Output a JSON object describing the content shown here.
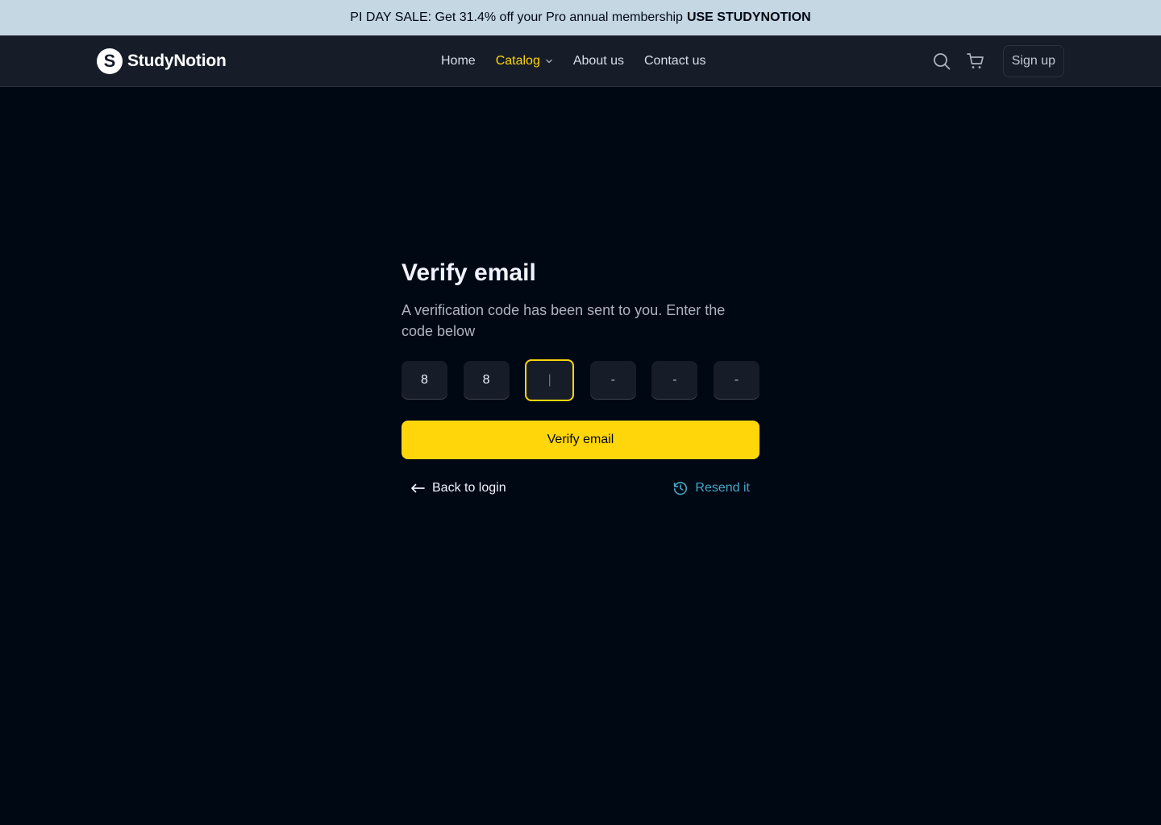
{
  "promo": {
    "text": "PI DAY SALE: Get 31.4% off your Pro annual membership",
    "code": "USE STUDYNOTION",
    "background": "#C5D7E3"
  },
  "navbar": {
    "logo_mark": "S",
    "logo_text": "StudyNotion",
    "links": [
      {
        "label": "Home"
      },
      {
        "label": "Catalog",
        "active": true,
        "icon": "chevron-down-icon"
      },
      {
        "label": "About us"
      },
      {
        "label": "Contact us"
      }
    ],
    "actions": {
      "search_icon": "search-icon",
      "cart_icon": "cart-icon",
      "signup_label": "Sign up"
    },
    "accent": "#FFD60A"
  },
  "verify": {
    "title": "Verify email",
    "subtitle": "A verification code has been sent to you. Enter the code below",
    "otp": [
      {
        "value": "8"
      },
      {
        "value": "8"
      },
      {
        "value": "|",
        "focused": true
      },
      {
        "value": "-"
      },
      {
        "value": "-"
      },
      {
        "value": "-"
      }
    ],
    "button_label": "Verify email",
    "back_label": "Back to login",
    "back_icon": "arrow-left-icon",
    "resend_label": "Resend it",
    "resend_icon": "history-icon",
    "button_color": "#FFD60A",
    "resend_color": "#47A5C5"
  }
}
